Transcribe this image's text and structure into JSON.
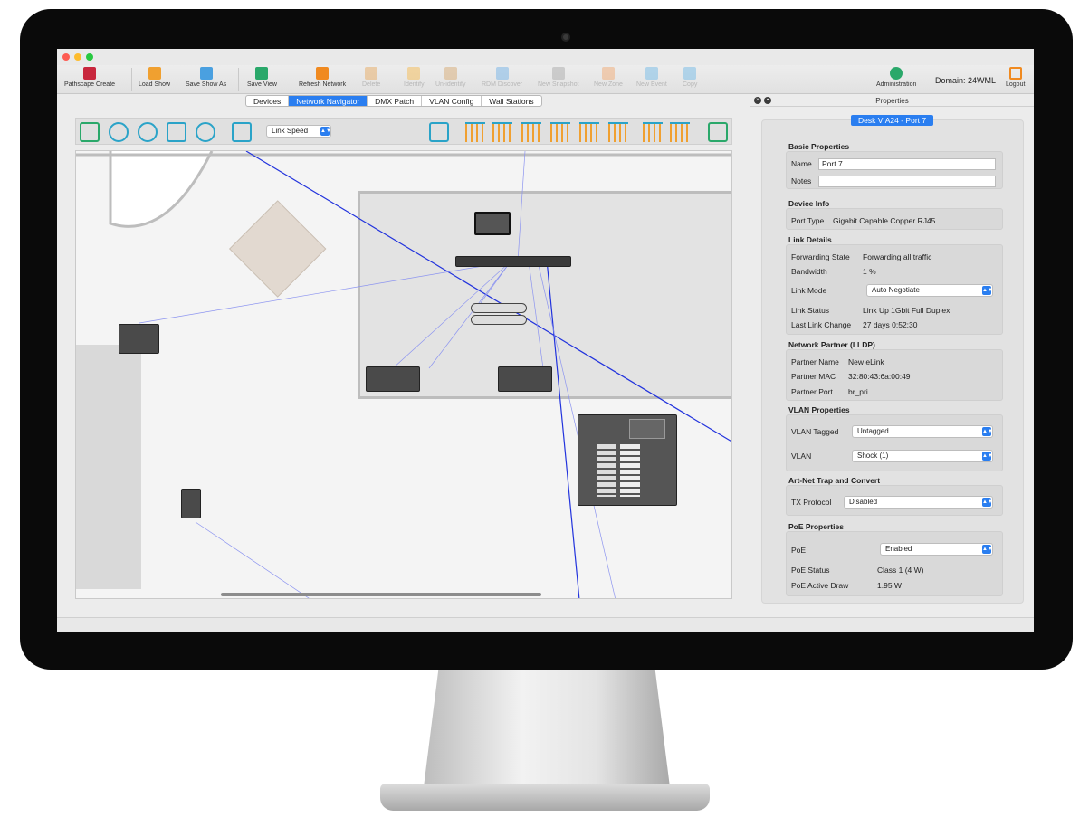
{
  "app": {
    "toolbar": {
      "buttons": [
        {
          "label": "Pathscape Create",
          "icon": "pathscape-icon",
          "color": "#c8273d",
          "enabled": true
        },
        {
          "label": "Load Show",
          "icon": "folder-open-icon",
          "color": "#f0a030",
          "enabled": true
        },
        {
          "label": "Save Show As",
          "icon": "save-as-icon",
          "color": "#4aa0e0",
          "enabled": true
        },
        {
          "label": "Save View",
          "icon": "save-view-icon",
          "color": "#2aa86a",
          "enabled": true
        },
        {
          "label": "Refresh Network",
          "icon": "refresh-icon",
          "color": "#f08a20",
          "enabled": true
        },
        {
          "label": "Delete",
          "icon": "trash-icon",
          "color": "#e8b070",
          "enabled": false
        },
        {
          "label": "Identify",
          "icon": "lightbulb-icon",
          "color": "#f4c060",
          "enabled": false
        },
        {
          "label": "Un-identify",
          "icon": "lightbulb-off-icon",
          "color": "#d8b080",
          "enabled": false
        },
        {
          "label": "RDM Discover",
          "icon": "rdm-icon",
          "color": "#80b8e8",
          "enabled": false
        },
        {
          "label": "New Snapshot",
          "icon": "snapshot-icon",
          "color": "#b0b0b0",
          "enabled": false
        },
        {
          "label": "New Zone",
          "icon": "zone-icon",
          "color": "#f0b080",
          "enabled": false
        },
        {
          "label": "New Event",
          "icon": "clock-icon",
          "color": "#80c0e8",
          "enabled": false
        },
        {
          "label": "Copy",
          "icon": "copy-icon",
          "color": "#80c0e8",
          "enabled": false
        }
      ],
      "admin_label": "Administration",
      "domain_text": "Domain: 24WML",
      "logout_label": "Logout"
    },
    "tabs": [
      {
        "label": "Devices",
        "active": false
      },
      {
        "label": "Network Navigator",
        "active": true
      },
      {
        "label": "DMX Patch",
        "active": false
      },
      {
        "label": "VLAN Config",
        "active": false
      },
      {
        "label": "Wall Stations",
        "active": false
      }
    ],
    "navigator": {
      "tools": [
        "fit-to-window-icon",
        "zoom-in-icon",
        "zoom-out-icon",
        "zoom-rect-icon",
        "zoom-reset-icon",
        "map-icon"
      ],
      "overlay_select": "Link Speed",
      "align_tools": [
        "select-all-icon",
        "align-left-icon",
        "align-center-h-icon",
        "align-right-icon",
        "align-top-icon",
        "align-center-v-icon",
        "align-bottom-icon",
        "distribute-h-icon",
        "distribute-v-icon",
        "lock-icon"
      ],
      "accent": "#2aa3c8"
    },
    "properties": {
      "header": "Properties",
      "selected": "Desk VIA24 - Port 7",
      "basic": {
        "title": "Basic Properties",
        "name_label": "Name",
        "name_value": "Port 7",
        "notes_label": "Notes",
        "notes_value": ""
      },
      "device_info": {
        "title": "Device Info",
        "port_type_label": "Port Type",
        "port_type_value": "Gigabit Capable Copper RJ45"
      },
      "link": {
        "title": "Link Details",
        "forwarding_label": "Forwarding State",
        "forwarding_value": "Forwarding all traffic",
        "bandwidth_label": "Bandwidth",
        "bandwidth_value": "1 %",
        "mode_label": "Link Mode",
        "mode_value": "Auto Negotiate",
        "status_label": "Link Status",
        "status_value": "Link Up 1Gbit Full Duplex",
        "last_change_label": "Last Link Change",
        "last_change_value": "27 days 0:52:30"
      },
      "lldp": {
        "title": "Network Partner (LLDP)",
        "name_label": "Partner Name",
        "name_value": "New eLink",
        "mac_label": "Partner MAC",
        "mac_value": "32:80:43:6a:00:49",
        "port_label": "Partner Port",
        "port_value": "br_pri"
      },
      "vlan": {
        "title": "VLAN Properties",
        "tagged_label": "VLAN Tagged",
        "tagged_value": "Untagged",
        "vlan_label": "VLAN",
        "vlan_value": "Shock (1)"
      },
      "artnet": {
        "title": "Art-Net Trap and Convert",
        "tx_label": "TX Protocol",
        "tx_value": "Disabled"
      },
      "poe": {
        "title": "PoE Properties",
        "poe_label": "PoE",
        "poe_value": "Enabled",
        "status_label": "PoE Status",
        "status_value": "Class 1 (4 W)",
        "draw_label": "PoE Active Draw",
        "draw_value": "1.95 W"
      }
    }
  }
}
